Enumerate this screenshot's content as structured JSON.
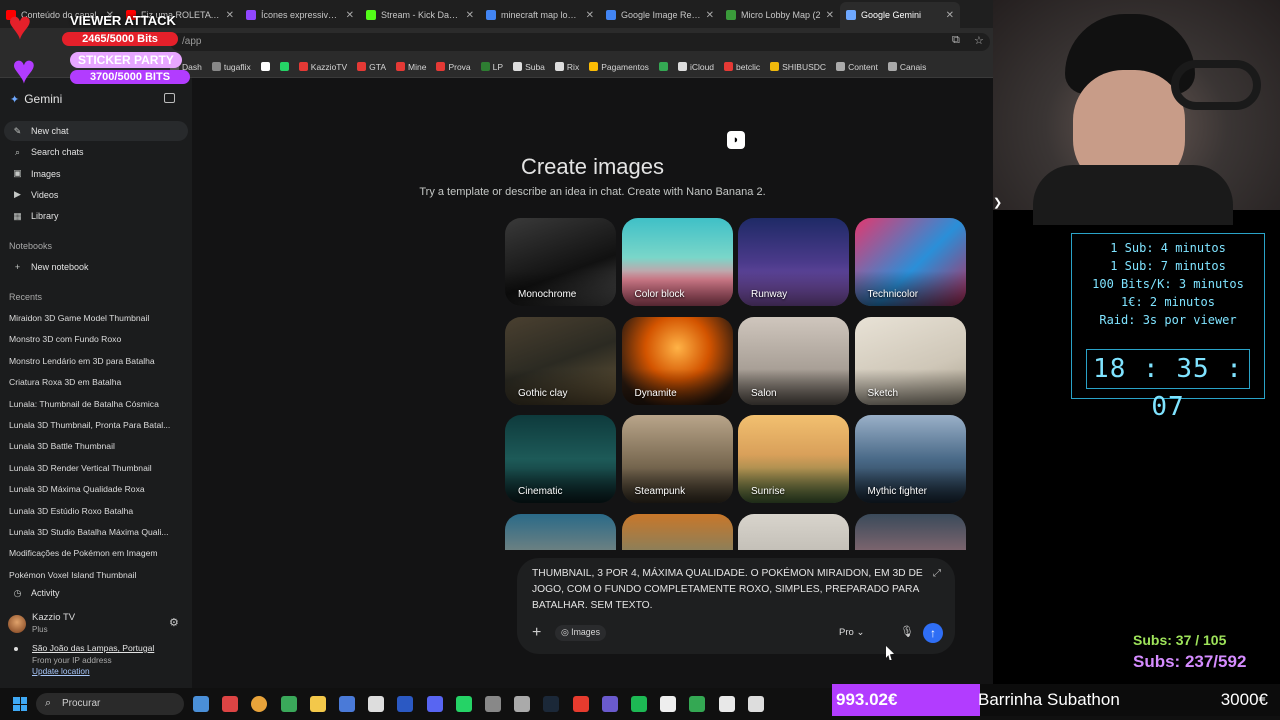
{
  "browser": {
    "tabs": [
      {
        "title": "Conteúdo do canal",
        "color": "#ff0000"
      },
      {
        "title": "Fiz uma ROLETA PO",
        "color": "#ff0000"
      },
      {
        "title": "Ícones expressivos -",
        "color": "#9146ff"
      },
      {
        "title": "Stream - Kick Dashb",
        "color": "#53fc18"
      },
      {
        "title": "minecraft map lobby",
        "color": "#4285f4"
      },
      {
        "title": "Google Image Result",
        "color": "#4285f4"
      },
      {
        "title": "Micro Lobby Map (2",
        "color": "#3a9b3a"
      },
      {
        "title": "Google Gemini",
        "color": "#6ea8ff"
      }
    ],
    "url": "/app",
    "bookmarks": [
      {
        "label": "Dash",
        "color": "#555"
      },
      {
        "label": "tugaflix",
        "color": "#888"
      },
      {
        "label": "",
        "color": "#fff"
      },
      {
        "label": "",
        "color": "#25d366"
      },
      {
        "label": "KazzioTV",
        "color": "#e53935"
      },
      {
        "label": "GTA",
        "color": "#e53935"
      },
      {
        "label": "Mine",
        "color": "#e53935"
      },
      {
        "label": "Prova",
        "color": "#e53935"
      },
      {
        "label": "LP",
        "color": "#2e7d32"
      },
      {
        "label": "Suba",
        "color": "#ddd"
      },
      {
        "label": "Rix",
        "color": "#ddd"
      },
      {
        "label": "Pagamentos",
        "color": "#fbbc04"
      },
      {
        "label": "",
        "color": "#34a853"
      },
      {
        "label": "iCloud",
        "color": "#ddd"
      },
      {
        "label": "betclic",
        "color": "#e53935"
      },
      {
        "label": "SHIBUSDC",
        "color": "#f0b90b"
      },
      {
        "label": "Content",
        "color": "#aaa"
      },
      {
        "label": "Canais",
        "color": "#aaa"
      }
    ]
  },
  "sidebar": {
    "brand": "Gemini",
    "nav": [
      {
        "label": "New chat",
        "icon": "edit-icon",
        "glyph": "✎"
      },
      {
        "label": "Search chats",
        "icon": "search-icon",
        "glyph": "⌕"
      },
      {
        "label": "Images",
        "icon": "image-icon",
        "glyph": "▣"
      },
      {
        "label": "Videos",
        "icon": "video-icon",
        "glyph": "▶"
      },
      {
        "label": "Library",
        "icon": "library-icon",
        "glyph": "▦"
      }
    ],
    "notebooks_heading": "Notebooks",
    "new_notebook": "New notebook",
    "recents_heading": "Recents",
    "recents": [
      "Miraidon 3D Game Model Thumbnail",
      "Monstro 3D com Fundo Roxo",
      "Monstro Lendário em 3D para Batalha",
      "Criatura Roxa 3D em Batalha",
      "Lunala: Thumbnail de Batalha Cósmica",
      "Lunala 3D Thumbnail, Pronta Para Batal...",
      "Lunala 3D Battle Thumbnail",
      "Lunala 3D Render Vertical Thumbnail",
      "Lunala 3D Máxima Qualidade Roxa",
      "Lunala 3D Estúdio Roxo Batalha",
      "Lunala 3D Studio Batalha Máxima Quali...",
      "Modificações de Pokémon em Imagem",
      "Pokémon Voxel Island Thumbnail"
    ],
    "activity": "Activity",
    "user_name": "Kazzio TV",
    "user_plan": "Plus",
    "location": "São João das Lampas, Portugal",
    "location_source": "From your IP address",
    "update_location": "Update location"
  },
  "main": {
    "title": "Create images",
    "subtitle": "Try a template or describe an idea in chat. Create with Nano Banana 2.",
    "templates": [
      {
        "label": "Monochrome",
        "bg": "linear-gradient(160deg,#3a3a3a,#111 60%,#555)"
      },
      {
        "label": "Color block",
        "bg": "linear-gradient(180deg,#3fc0c7 0%,#7ad6c9 45%,#e88a9a 70%,#d25f7a)"
      },
      {
        "label": "Runway",
        "bg": "linear-gradient(180deg,#1e2a66,#4a3a8a 50%,#8a5ab8)"
      },
      {
        "label": "Technicolor",
        "bg": "linear-gradient(135deg,#e2386f,#2a8fd8 55%,#b82b5a)"
      },
      {
        "label": "Gothic clay",
        "bg": "linear-gradient(160deg,#4a4030,#2b2a22 50%,#6b5a3a)"
      },
      {
        "label": "Dynamite",
        "bg": "radial-gradient(circle at 50% 35%,#ffb347,#d35400 40%,#2a1a10 80%)"
      },
      {
        "label": "Salon",
        "bg": "linear-gradient(180deg,#cfc6bd,#a89f96 60%,#6a625a)"
      },
      {
        "label": "Sketch",
        "bg": "linear-gradient(160deg,#e8e2d6,#cfc7b8 60%,#a89f8c)"
      },
      {
        "label": "Cinematic",
        "bg": "linear-gradient(180deg,#0e3a3c,#1d5a58 50%,#0a1f22)"
      },
      {
        "label": "Steampunk",
        "bg": "linear-gradient(180deg,#b9a58a,#7a6a52 55%,#3a3226)"
      },
      {
        "label": "Sunrise",
        "bg": "linear-gradient(180deg,#f2c070,#d9a05a 45%,#4a6a3a)"
      },
      {
        "label": "Mythic fighter",
        "bg": "linear-gradient(180deg,#9ab0c8,#4a6a88 50%,#1a2a3a)"
      },
      {
        "label": "",
        "bg": "linear-gradient(180deg,#2a6a88,#c9a07a)"
      },
      {
        "label": "",
        "bg": "linear-gradient(180deg,#c8772a,#3a8a9a)"
      },
      {
        "label": "",
        "bg": "linear-gradient(180deg,#d8d4cc,#a8a49c)"
      },
      {
        "label": "",
        "bg": "linear-gradient(180deg,#3a4a5a,#d88a8a)"
      }
    ],
    "prompt_text": "THUMBNAIL, 3 POR 4, MÁXIMA QUALIDADE. O POKÉMON MIRAIDON, EM 3D DE JOGO, COM O FUNDO COMPLETAMENTE ROXO, SIMPLES, PREPARADO PARA BATALHAR. SEM TEXTO.",
    "images_chip": "Images",
    "model": "Pro"
  },
  "taskbar": {
    "search_placeholder": "Procurar",
    "apps": [
      "#4a8fd8",
      "#d44",
      "#e8a33a",
      "#3aa85a",
      "#f3c84a",
      "#4a7ad8",
      "#ddd",
      "#2b59c3",
      "#5865f2",
      "#25d366",
      "#888",
      "#aaa",
      "#1b2838",
      "#e63b2e",
      "#6a5acd",
      "#1db954",
      "#eee",
      "#34a853",
      "#e8e8e8",
      "#ddd"
    ]
  },
  "overlay": {
    "viewer_attack": "VIEWER ATTACK",
    "viewer_bits": "2465/5000 Bits",
    "sticker_party": "STICKER PARTY",
    "sticker_bits": "3700/5000 BITS",
    "info_lines": [
      "1 Sub: 4 minutos",
      "1 Sub: 7 minutos",
      "100 Bits/K: 3 minutos",
      "1€: 2 minutos",
      "Raid: 3s por viewer"
    ],
    "clock": "18 : 35 : 07",
    "subs_line1": "Subs: 37 / 105",
    "subs_line2": "Subs: 237/592",
    "bar_amount": "993.02€",
    "bar_name": "Barrinha Subathon",
    "bar_goal": "3000€",
    "bar_fraction": 0.331
  }
}
